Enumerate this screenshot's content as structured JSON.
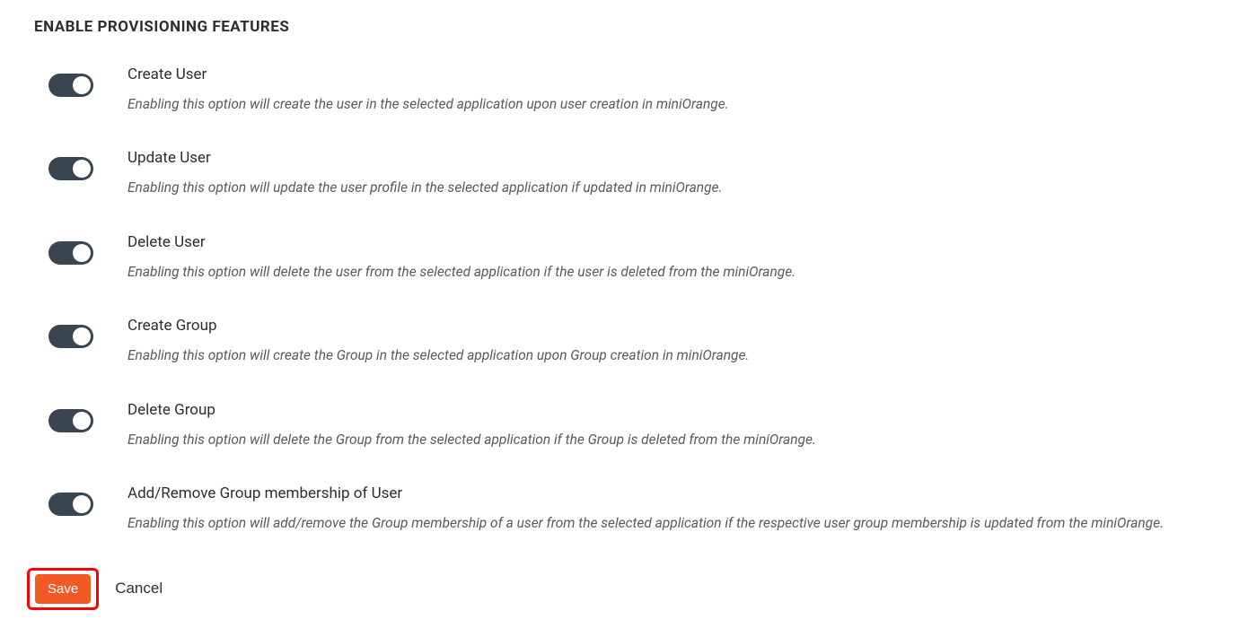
{
  "section_title": "ENABLE PROVISIONING FEATURES",
  "features": [
    {
      "label": "Create User",
      "desc": "Enabling this option will create the user in the selected application upon user creation in miniOrange.",
      "enabled": true
    },
    {
      "label": "Update User",
      "desc": "Enabling this option will update the user profile in the selected application if updated in miniOrange.",
      "enabled": true
    },
    {
      "label": "Delete User",
      "desc": "Enabling this option will delete the user from the selected application if the user is deleted from the miniOrange.",
      "enabled": true
    },
    {
      "label": "Create Group",
      "desc": "Enabling this option will create the Group in the selected application upon Group creation in miniOrange.",
      "enabled": true
    },
    {
      "label": "Delete Group",
      "desc": "Enabling this option will delete the Group from the selected application if the Group is deleted from the miniOrange.",
      "enabled": true
    },
    {
      "label": "Add/Remove Group membership of User",
      "desc": "Enabling this option will add/remove the Group membership of a user from the selected application if the respective user group membership is updated from the miniOrange.",
      "enabled": true
    }
  ],
  "actions": {
    "save_label": "Save",
    "cancel_label": "Cancel"
  }
}
